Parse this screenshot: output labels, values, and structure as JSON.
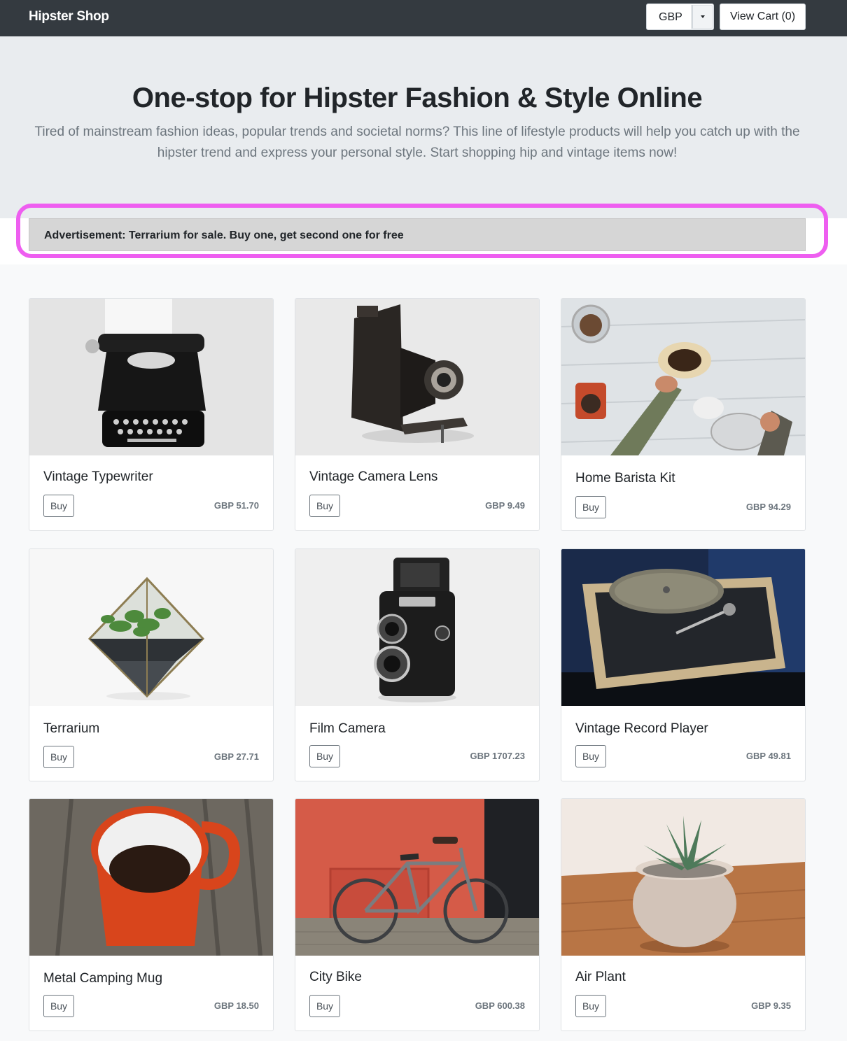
{
  "navbar": {
    "brand": "Hipster Shop",
    "currency": "GBP",
    "cart_label": "View Cart (0)"
  },
  "hero": {
    "title": "One-stop for Hipster Fashion & Style Online",
    "text": "Tired of mainstream fashion ideas, popular trends and societal norms? This line of lifestyle products will help you catch up with the hipster trend and express your personal style. Start shopping hip and vintage items now!"
  },
  "ad": {
    "text": "Advertisement: Terrarium for sale. Buy one, get second one for free",
    "highlight_color": "#ee5ef0"
  },
  "products": [
    {
      "name": "Vintage Typewriter",
      "buy": "Buy",
      "price": "GBP 51.70",
      "icon": "typewriter-image"
    },
    {
      "name": "Vintage Camera Lens",
      "buy": "Buy",
      "price": "GBP 9.49",
      "icon": "folding-camera-image"
    },
    {
      "name": "Home Barista Kit",
      "buy": "Buy",
      "price": "GBP 94.29",
      "icon": "coffee-kit-image"
    },
    {
      "name": "Terrarium",
      "buy": "Buy",
      "price": "GBP 27.71",
      "icon": "terrarium-image"
    },
    {
      "name": "Film Camera",
      "buy": "Buy",
      "price": "GBP 1707.23",
      "icon": "film-camera-image"
    },
    {
      "name": "Vintage Record Player",
      "buy": "Buy",
      "price": "GBP 49.81",
      "icon": "record-player-image"
    },
    {
      "name": "Metal Camping Mug",
      "buy": "Buy",
      "price": "GBP 18.50",
      "icon": "mug-image"
    },
    {
      "name": "City Bike",
      "buy": "Buy",
      "price": "GBP 600.38",
      "icon": "bike-image"
    },
    {
      "name": "Air Plant",
      "buy": "Buy",
      "price": "GBP 9.35",
      "icon": "plant-image"
    }
  ]
}
